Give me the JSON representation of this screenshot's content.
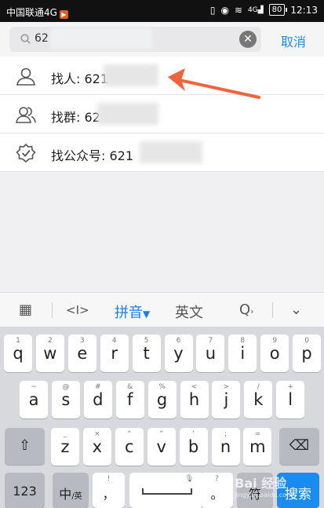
{
  "status_bar": {
    "carrier": "中国联通4G",
    "signal_badge": "4G",
    "battery": "80",
    "time": "12:13"
  },
  "search": {
    "query": "62",
    "cancel_label": "取消"
  },
  "results": [
    {
      "label": "找人: 621",
      "icon": "person-icon"
    },
    {
      "label": "找群: 62",
      "icon": "group-icon"
    },
    {
      "label": "找公众号: 621",
      "icon": "badge-check-icon"
    }
  ],
  "keyboard_toolbar": {
    "pinyin": "拼音",
    "english": "英文"
  },
  "keyboard": {
    "row1": [
      {
        "hint": "1",
        "ch": "q"
      },
      {
        "hint": "2",
        "ch": "w"
      },
      {
        "hint": "3",
        "ch": "e"
      },
      {
        "hint": "4",
        "ch": "r"
      },
      {
        "hint": "5",
        "ch": "t"
      },
      {
        "hint": "6",
        "ch": "y"
      },
      {
        "hint": "7",
        "ch": "u"
      },
      {
        "hint": "8",
        "ch": "i"
      },
      {
        "hint": "9",
        "ch": "o"
      },
      {
        "hint": "0",
        "ch": "p"
      }
    ],
    "row2": [
      {
        "hint": "~",
        "ch": "a"
      },
      {
        "hint": "@",
        "ch": "s"
      },
      {
        "hint": "#",
        "ch": "d"
      },
      {
        "hint": "&",
        "ch": "f"
      },
      {
        "hint": "%",
        "ch": "g"
      },
      {
        "hint": "<",
        "ch": "h"
      },
      {
        "hint": ">",
        "ch": "j"
      },
      {
        "hint": "/",
        "ch": "k"
      },
      {
        "hint": "+",
        "ch": "l"
      }
    ],
    "row3": [
      {
        "hint": "_",
        "ch": "z"
      },
      {
        "hint": "×",
        "ch": "x"
      },
      {
        "hint": "“",
        "ch": "c"
      },
      {
        "hint": "”",
        "ch": "v"
      },
      {
        "hint": "'",
        "ch": "b"
      },
      {
        "hint": ";",
        "ch": "n"
      },
      {
        "hint": "=",
        "ch": "m"
      }
    ],
    "num_label": "123",
    "lang_label": "中",
    "lang_sub": "/英",
    "comma_label": "，",
    "comma_hint": "!",
    "period_label": "。",
    "period_hint": "?",
    "extra_label": "符",
    "search_label": "搜索"
  },
  "watermark": {
    "text": "Bai 经验",
    "sub": "jingyan.baidu.com"
  },
  "colors": {
    "accent": "#1a8cf0",
    "arrow": "#f0643c"
  }
}
